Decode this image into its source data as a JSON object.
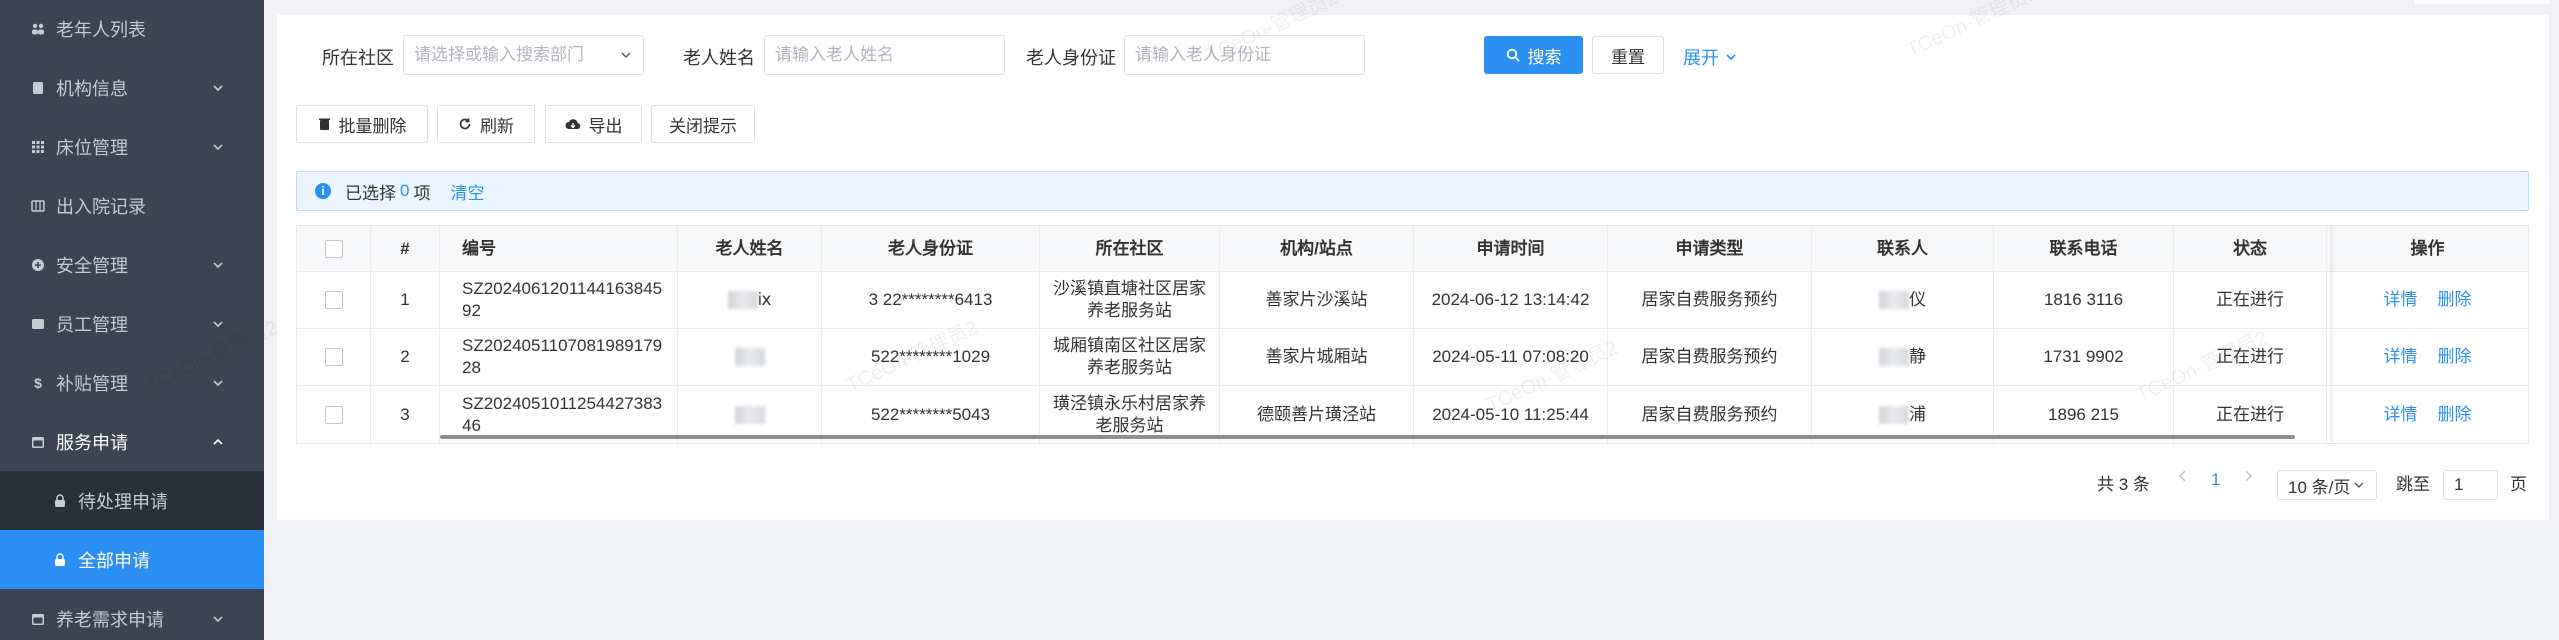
{
  "sidebar": {
    "items": [
      {
        "label": "老年人列表",
        "icon": "people-icon",
        "type": "plain"
      },
      {
        "label": "机构信息",
        "icon": "building-icon",
        "type": "collapsed"
      },
      {
        "label": "床位管理",
        "icon": "grid-icon",
        "type": "collapsed"
      },
      {
        "label": "出入院记录",
        "icon": "record-icon",
        "type": "plain"
      },
      {
        "label": "安全管理",
        "icon": "plus-circle-icon",
        "type": "collapsed"
      },
      {
        "label": "员工管理",
        "icon": "staff-icon",
        "type": "collapsed"
      },
      {
        "label": "补贴管理",
        "icon": "dollar-icon",
        "type": "collapsed"
      },
      {
        "label": "服务申请",
        "icon": "calendar-icon",
        "type": "open"
      },
      {
        "label": "待处理申请",
        "icon": "lock-icon",
        "type": "sub"
      },
      {
        "label": "全部申请",
        "icon": "lock-icon",
        "type": "sub-active"
      },
      {
        "label": "养老需求申请",
        "icon": "calendar-icon",
        "type": "collapsed"
      }
    ]
  },
  "search": {
    "community_label": "所在社区",
    "community_placeholder": "请选择或输入搜索部门",
    "name_label": "老人姓名",
    "name_placeholder": "请输入老人姓名",
    "id_label": "老人身份证",
    "id_placeholder": "请输入老人身份证",
    "search_btn": "搜索",
    "reset_btn": "重置",
    "expand_btn": "展开"
  },
  "toolbar": {
    "batch_delete": "批量删除",
    "refresh": "刷新",
    "export": "导出",
    "close_tip": "关闭提示"
  },
  "alert": {
    "prefix": "已选择",
    "count": "0",
    "suffix": "项",
    "clear": "清空"
  },
  "table": {
    "columns": [
      "#",
      "编号",
      "老人姓名",
      "老人身份证",
      "所在社区",
      "机构/站点",
      "申请时间",
      "申请类型",
      "联系人",
      "联系电话",
      "状态",
      "操作"
    ],
    "rows": [
      {
        "idx": "1",
        "code": "SZ202406120114416384592",
        "name": "ⅸ",
        "id_card": "3 22********6413",
        "community": "沙溪镇直塘社区居家养老服务站",
        "station": "善家片沙溪站",
        "time": "2024-06-12 13:14:42",
        "type": "居家自费服务预约",
        "contact": "仪",
        "phone": "1816 3116",
        "status": "正在进行",
        "op_detail": "详情",
        "op_delete": "删除"
      },
      {
        "idx": "2",
        "code": "SZ202405110708198917928",
        "name": "",
        "id_card": "522********1029",
        "community": "城厢镇南区社区居家养老服务站",
        "station": "善家片城厢站",
        "time": "2024-05-11 07:08:20",
        "type": "居家自费服务预约",
        "contact": "静",
        "phone": "1731 9902",
        "status": "正在进行",
        "op_detail": "详情",
        "op_delete": "删除"
      },
      {
        "idx": "3",
        "code": "SZ202405101125442738346",
        "name": "",
        "id_card": "522********5043",
        "community": "璜泾镇永乐村居家养老服务站",
        "station": "德颐善片璜泾站",
        "time": "2024-05-10 11:25:44",
        "type": "居家自费服务预约",
        "contact": "浦",
        "phone": "1896 215",
        "status": "正在进行",
        "op_detail": "详情",
        "op_delete": "删除"
      }
    ]
  },
  "pagination": {
    "total": "共 3 条",
    "current": "1",
    "page_size": "10 条/页",
    "jump_label": "跳至",
    "jump_value": "1",
    "page_unit": "页"
  },
  "watermark": "TCeOn-管理员2",
  "colors": {
    "primary": "#2b8ff3",
    "sidebar": "#3c4453",
    "sidebar_active": "#2b8ff3"
  }
}
